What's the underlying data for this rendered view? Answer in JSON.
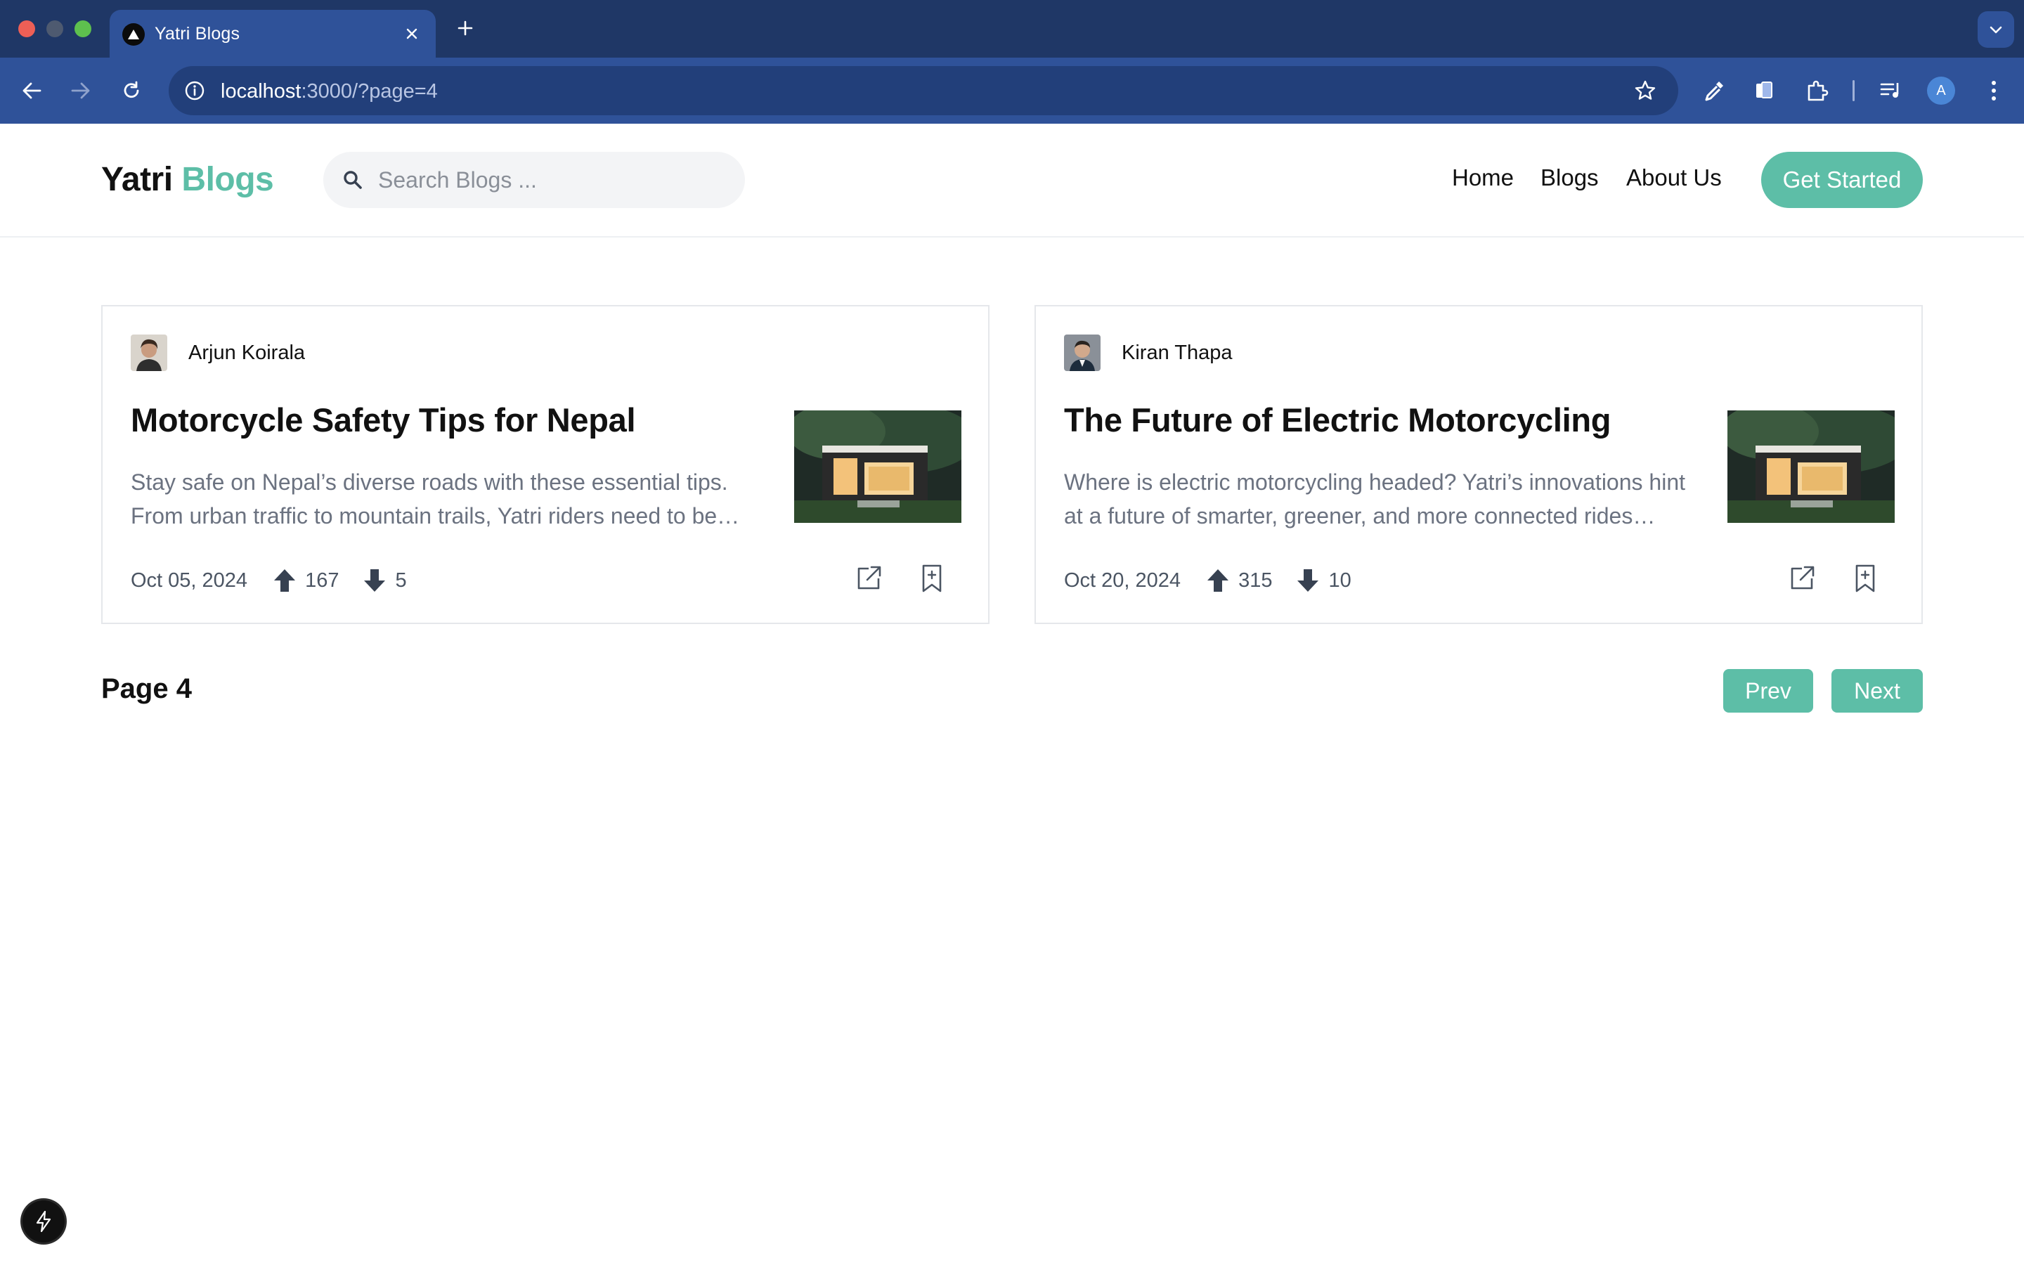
{
  "browser": {
    "tab_title": "Yatri Blogs",
    "url_host": "localhost",
    "url_rest": ":3000/?page=4",
    "profile_initial": "A"
  },
  "header": {
    "logo_main": "Yatri",
    "logo_accent": "Blogs",
    "search_placeholder": "Search Blogs ...",
    "nav": [
      "Home",
      "Blogs",
      "About Us"
    ],
    "cta_label": "Get Started"
  },
  "posts": [
    {
      "author": "Arjun Koirala",
      "title": "Motorcycle Safety Tips for Nepal",
      "excerpt_line1": "Stay safe on Nepal’s diverse roads with these essential tips.",
      "excerpt_line2": "From urban traffic to mountain trails, Yatri riders need to be…",
      "date": "Oct 05, 2024",
      "upvotes": "167",
      "downvotes": "5"
    },
    {
      "author": "Kiran Thapa",
      "title": "The Future of Electric Motorcycling",
      "excerpt_line1": "Where is electric motorcycling headed? Yatri’s innovations hint",
      "excerpt_line2": "at a future of smarter, greener, and more connected rides…",
      "date": "Oct 20, 2024",
      "upvotes": "315",
      "downvotes": "10"
    }
  ],
  "pagination": {
    "label": "Page 4",
    "prev": "Prev",
    "next": "Next"
  },
  "colors": {
    "accent": "#5dbea7",
    "chrome_dark": "#1f3766",
    "chrome": "#2f5299"
  }
}
